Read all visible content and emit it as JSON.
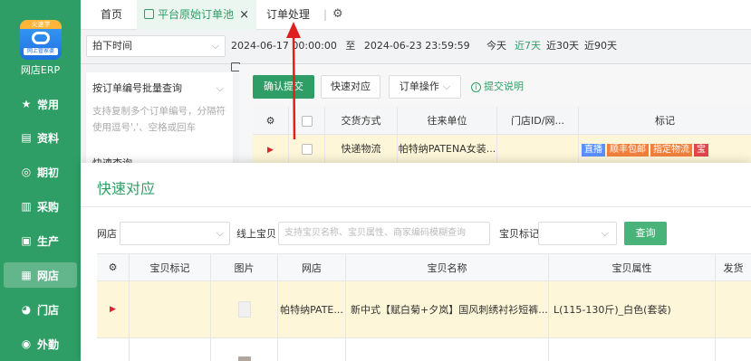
{
  "sidebar": {
    "logo_tag": "火速学",
    "logo_caption": "网上管家婆",
    "brand": "网店ERP",
    "items": [
      {
        "label": "常用",
        "icon": "star-icon"
      },
      {
        "label": "资料",
        "icon": "document-icon"
      },
      {
        "label": "期初",
        "icon": "target-icon"
      },
      {
        "label": "采购",
        "icon": "barcode-icon"
      },
      {
        "label": "生产",
        "icon": "box-icon"
      },
      {
        "label": "网店",
        "icon": "shop-icon",
        "active": true
      },
      {
        "label": "门店",
        "icon": "pie-icon"
      },
      {
        "label": "外勤",
        "icon": "compass-icon"
      }
    ]
  },
  "tabs": {
    "home": "首页",
    "pool": "平台原始订单池",
    "close": "×",
    "process": "订单处理",
    "sep": "|",
    "gear": "⚙"
  },
  "filter": {
    "time_select": "拍下时间",
    "date_start": "2024-06-17 00:00:00",
    "date_to": "至",
    "date_end": "2024-06-23 23:59:59",
    "today": "今天",
    "last7": "近7天",
    "last30": "近30天",
    "last90": "近90天"
  },
  "query_panel": {
    "select": "按订单编号批量查询",
    "placeholder_line1": "支持复制多个订单编号，分隔符",
    "placeholder_line2": "使用逗号','、空格或回车",
    "quick_query": "快速查询"
  },
  "toolbar": {
    "confirm": "确认提交",
    "quick_match": "快速对应",
    "order_op": "订单操作",
    "help": "提交说明"
  },
  "bg_table": {
    "headers": [
      "交货方式",
      "往来单位",
      "门店ID/网...",
      "标记"
    ],
    "row": {
      "delivery": "快递物流",
      "partner": "帕特纳PATENA女装..."
    },
    "badges": [
      {
        "text": "直播",
        "color": "#5b8ff9"
      },
      {
        "text": "顺丰包邮",
        "color": "#f0803c"
      },
      {
        "text": "指定物流",
        "color": "#f0803c"
      },
      {
        "text": "宝",
        "color": "#e0454a"
      }
    ]
  },
  "modal": {
    "title": "快速对应",
    "shop_label": "网店",
    "online_label": "线上宝贝",
    "online_placeholder": "支持宝贝名称、宝贝属性、商家编码模糊查询",
    "mark_label": "宝贝标记",
    "search_btn": "查询",
    "headers": [
      "⚙",
      "宝贝标记",
      "图片",
      "网店",
      "宝贝名称",
      "宝贝属性",
      "发货"
    ],
    "rows": [
      {
        "shop": "帕特纳PATE...",
        "name": "新中式【赋白菊+夕岚】国风刺绣衬衫短裤...",
        "attr": "L(115-130斤)_白色(套装)"
      }
    ]
  }
}
